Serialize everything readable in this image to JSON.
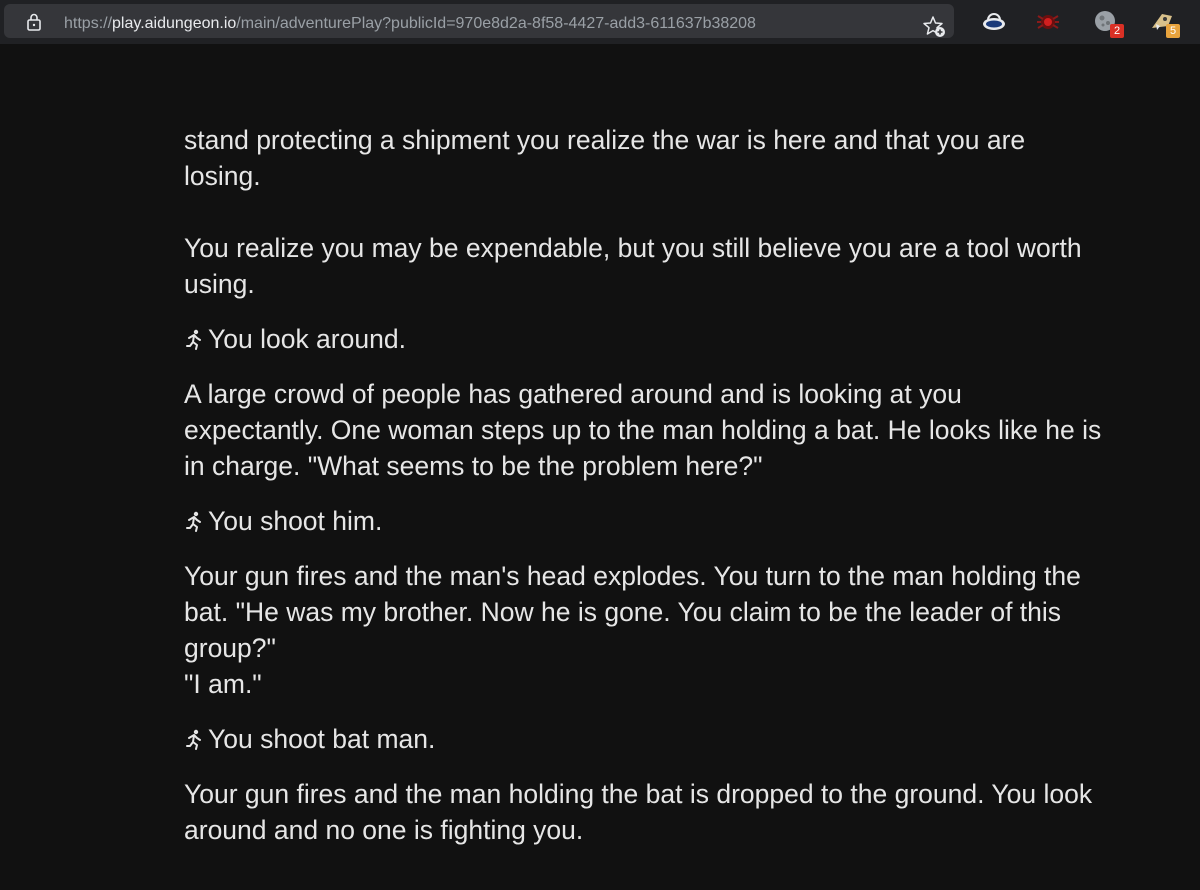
{
  "browser": {
    "url_scheme": "https://",
    "url_host": "play.aidungeon.io",
    "url_path": "/main/adventurePlay?publicId=970e8d2a-8f58-4427-add3-611637b38208",
    "extensions": [
      {
        "icon": "cloud-extension-icon",
        "badge": ""
      },
      {
        "icon": "spider-extension-icon",
        "badge": ""
      },
      {
        "icon": "moon-extension-icon",
        "badge": "2",
        "badge_color": "#d93025"
      },
      {
        "icon": "rocket-extension-icon",
        "badge": "5",
        "badge_color": "#e8a33d"
      }
    ]
  },
  "story": {
    "intro": {
      "lines": [
        "stand protecting a shipment you realize the war is here and that you are",
        "losing."
      ]
    },
    "p1": {
      "lines": [
        "You realize you may be expendable, but you still believe you are a tool worth",
        "using."
      ]
    },
    "a1": "You look around.",
    "p2": {
      "lines": [
        "A large crowd of people has gathered around and is looking at you",
        "expectantly. One woman steps up to the man holding a bat. He looks like he is",
        "in charge. \"What seems to be the problem here?\""
      ]
    },
    "a2": "You shoot him.",
    "p3": {
      "lines": [
        "Your gun fires and the man's head explodes. You turn to the man holding the",
        "bat. \"He was my brother. Now he is gone. You claim to be the leader of this",
        "group?\"",
        "\"I am.\""
      ]
    },
    "a3": "You shoot bat man.",
    "p4": {
      "lines": [
        "Your gun fires and the man holding the bat is dropped to the ground. You look",
        "around and no one is fighting you."
      ]
    }
  }
}
